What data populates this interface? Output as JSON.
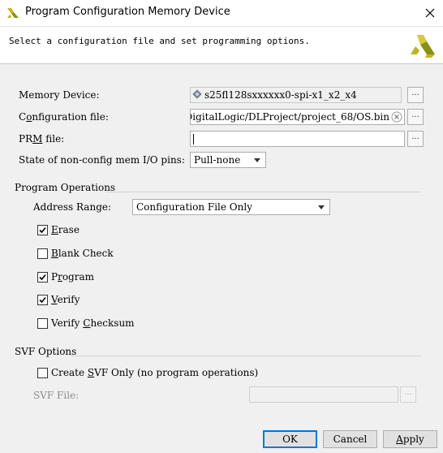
{
  "window": {
    "title": "Program Configuration Memory Device",
    "close_glyph": "✕"
  },
  "header": {
    "description": "Select a configuration file and set programming options."
  },
  "memory_device": {
    "label": "Memory Device:",
    "value": "s25fl128sxxxxxx0-spi-x1_x2_x4",
    "browse": "..."
  },
  "config_file": {
    "label_pre": "C",
    "label_u": "o",
    "label_post": "nfiguration file:",
    "value": "DigitalLogic/DLProject/project_68/OS.bin",
    "browse": "..."
  },
  "prm_file": {
    "label_pre": "PR",
    "label_u": "M",
    "label_post": " file:",
    "value": "",
    "browse": "..."
  },
  "state_pins": {
    "label": "State of non-config mem I/O pins:",
    "value": "Pull-none"
  },
  "program_operations": {
    "title": "Program Operations",
    "address_range": {
      "label": "Address Range:",
      "value": "Configuration File Only"
    },
    "options": [
      {
        "pre": "",
        "u": "E",
        "post": "rase",
        "checked": true
      },
      {
        "pre": "",
        "u": "B",
        "post": "lank Check",
        "checked": false
      },
      {
        "pre": "P",
        "u": "r",
        "post": "ogram",
        "checked": true
      },
      {
        "pre": "",
        "u": "V",
        "post": "erify",
        "checked": true
      },
      {
        "pre": "Verify ",
        "u": "C",
        "post": "hecksum",
        "checked": false
      }
    ]
  },
  "svf_options": {
    "title": "SVF Options",
    "create_svf": {
      "pre": "Create ",
      "u": "S",
      "post": "VF Only (no program operations)",
      "checked": false
    },
    "svf_file": {
      "label": "SVF File:",
      "value": "",
      "browse": "..."
    }
  },
  "buttons": {
    "ok": "OK",
    "cancel": "Cancel",
    "apply_u": "A",
    "apply_post": "pply"
  },
  "colors": {
    "accent": "#0078d7",
    "logo_yellow": "#d6c21e",
    "logo_green": "#8a8f18",
    "logo_olive": "#b8b52a"
  }
}
